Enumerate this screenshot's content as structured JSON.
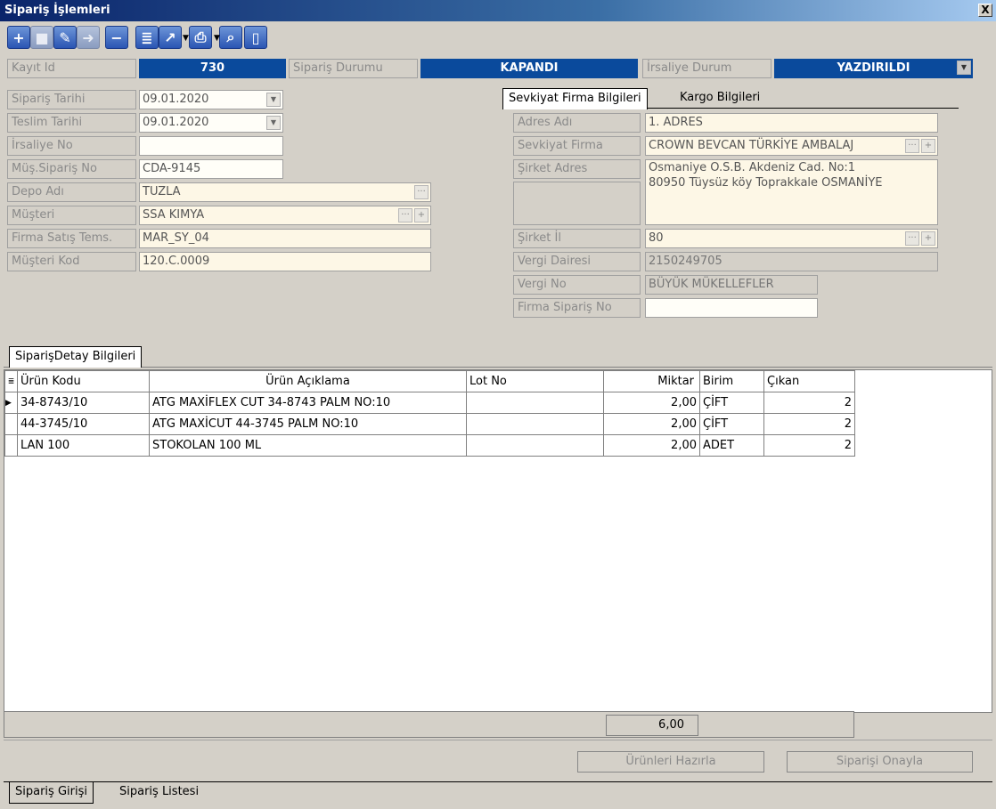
{
  "window": {
    "title": "Sipariş İşlemleri",
    "close_label": "X"
  },
  "toolbar": {
    "buttons": [
      {
        "icon": "plus-icon",
        "glyph": "+"
      },
      {
        "icon": "save-icon",
        "glyph": "■"
      },
      {
        "icon": "edit-icon",
        "glyph": "✎"
      },
      {
        "icon": "export-icon",
        "glyph": "➜"
      },
      {
        "icon": "minus-icon",
        "glyph": "−"
      },
      {
        "icon": "document-icon",
        "glyph": "≣"
      },
      {
        "icon": "chart-icon",
        "glyph": "↗"
      },
      {
        "icon": "print-icon",
        "glyph": "⎙"
      },
      {
        "icon": "binoculars-icon",
        "glyph": "⌕"
      },
      {
        "icon": "exit-door-icon",
        "glyph": "▯"
      }
    ]
  },
  "status": {
    "kayit_id_label": "Kayıt Id",
    "kayit_id_value": "730",
    "siparis_durumu_label": "Sipariş Durumu",
    "siparis_durumu_value": "KAPANDI",
    "irsaliye_durum_label": "İrsaliye Durum",
    "irsaliye_durum_value": "YAZDIRILDI"
  },
  "order": {
    "siparis_tarihi_label": "Sipariş Tarihi",
    "siparis_tarihi": "09.01.2020",
    "teslim_tarihi_label": "Teslim Tarihi",
    "teslim_tarihi": "09.01.2020",
    "irsaliye_no_label": "İrsaliye No",
    "irsaliye_no": "",
    "mus_siparis_no_label": "Müş.Sipariş No",
    "mus_siparis_no": "CDA-9145",
    "depo_adi_label": "Depo Adı",
    "depo_adi": "TUZLA",
    "musteri_label": "Müşteri",
    "musteri": "SSA KIMYA",
    "firma_satis_label": "Firma Satış Tems.",
    "firma_satis": "MAR_SY_04",
    "musteri_kod_label": "Müşteri Kod",
    "musteri_kod": "120.C.0009"
  },
  "shipment_tabs": [
    "Sevkiyat Firma Bilgileri",
    "Kargo Bilgileri"
  ],
  "shipment": {
    "adres_adi_label": "Adres Adı",
    "adres_adi": "1. ADRES",
    "sevkiyat_firma_label": "Sevkiyat Firma",
    "sevkiyat_firma": "CROWN BEVCAN TÜRKİYE AMBALAJ",
    "sirket_adres_label": "Şirket Adres",
    "sirket_adres_line1": "Osmaniye O.S.B. Akdeniz Cad. No:1",
    "sirket_adres_line2": "80950 Tüysüz köy Toprakkale OSMANİYE",
    "sirket_il_label": "Şirket İl",
    "sirket_il": "80",
    "vergi_dairesi_label": "Vergi Dairesi",
    "vergi_dairesi": "2150249705",
    "vergi_no_label": "Vergi No",
    "vergi_no": "BÜYÜK MÜKELLEFLER",
    "firma_siparis_no_label": "Firma Sipariş No",
    "firma_siparis_no": ""
  },
  "detail_tab": "SiparişDetay Bilgileri",
  "grid": {
    "columns": [
      "Ürün Kodu",
      "Ürün Açıklama",
      "Lot No",
      "Miktar",
      "Birim",
      "Çıkan"
    ],
    "rows": [
      {
        "urun_kodu": "34-8743/10",
        "aciklama": "ATG MAXİFLEX CUT 34-8743  PALM NO:10",
        "lot": "",
        "miktar": "2,00",
        "birim": "ÇİFT",
        "cikan": "2"
      },
      {
        "urun_kodu": "44-3745/10",
        "aciklama": "ATG MAXİCUT 44-3745  PALM   NO:10",
        "lot": "",
        "miktar": "2,00",
        "birim": "ÇİFT",
        "cikan": "2"
      },
      {
        "urun_kodu": "LAN 100",
        "aciklama": "STOKOLAN 100 ML",
        "lot": "",
        "miktar": "2,00",
        "birim": "ADET",
        "cikan": "2"
      }
    ],
    "total_miktar": "6,00"
  },
  "actions": {
    "urunleri_hazirla": "Ürünleri Hazırla",
    "siparisi_onayla": "Siparişi Onayla"
  },
  "bottom_tabs": [
    "Sipariş Girişi",
    "Sipariş Listesi"
  ]
}
